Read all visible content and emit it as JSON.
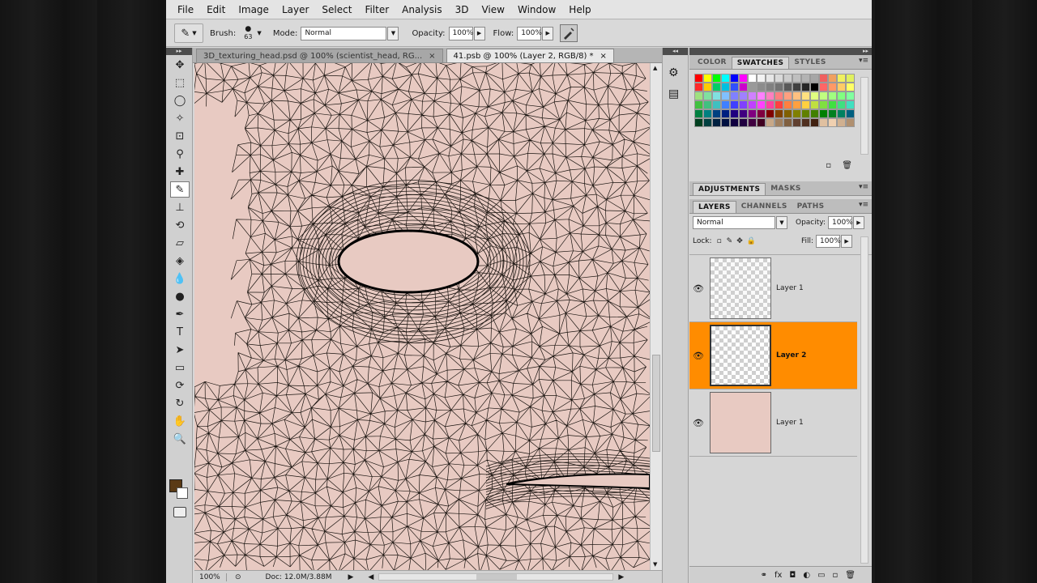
{
  "menu": [
    "File",
    "Edit",
    "Image",
    "Layer",
    "Select",
    "Filter",
    "Analysis",
    "3D",
    "View",
    "Window",
    "Help"
  ],
  "options": {
    "brush_label": "Brush:",
    "brush_size": "63",
    "mode_label": "Mode:",
    "mode_value": "Normal",
    "opacity_label": "Opacity:",
    "opacity_value": "100%",
    "flow_label": "Flow:",
    "flow_value": "100%"
  },
  "tabs": [
    {
      "label": "3D_texturing_head.psd @ 100% (scientist_head, RG...",
      "close": "×"
    },
    {
      "label": "41.psb @ 100% (Layer 2, RGB/8) *",
      "close": "×"
    }
  ],
  "status": {
    "zoom": "100%",
    "doc": "Doc: 12.0M/3.88M"
  },
  "swatches_panel": {
    "tabs": [
      "COLOR",
      "SWATCHES",
      "STYLES"
    ],
    "colors": [
      "#ff0000",
      "#ffff00",
      "#00ff00",
      "#00ffff",
      "#0000ff",
      "#ff00ff",
      "#ffffff",
      "#f2f2f2",
      "#e6e6e6",
      "#d9d9d9",
      "#cccccc",
      "#bfbfbf",
      "#b3b3b3",
      "#a6a6a6",
      "#f06060",
      "#f0a060",
      "#f0f060",
      "#e0f060",
      "#ff2a2a",
      "#ffcc00",
      "#00cc66",
      "#00c0e0",
      "#3050ff",
      "#cc00cc",
      "#999999",
      "#8c8c8c",
      "#808080",
      "#737373",
      "#595959",
      "#404040",
      "#262626",
      "#000000",
      "#ff6666",
      "#ff9966",
      "#ffcc66",
      "#ffff66",
      "#a0e080",
      "#80e0a0",
      "#80e0e0",
      "#80c0ff",
      "#8080ff",
      "#a080ff",
      "#d080ff",
      "#ff80ff",
      "#ff80c0",
      "#ff8080",
      "#ffa080",
      "#ffc080",
      "#ffe080",
      "#e0ff80",
      "#c0ff80",
      "#a0ff80",
      "#80ff80",
      "#80ffa0",
      "#40c040",
      "#40c080",
      "#40c0c0",
      "#4080ff",
      "#4040ff",
      "#8040ff",
      "#c040ff",
      "#ff40ff",
      "#ff40a0",
      "#ff4040",
      "#ff8040",
      "#ffa040",
      "#ffd040",
      "#c0e040",
      "#80e040",
      "#40e040",
      "#40e080",
      "#40e0c0",
      "#008040",
      "#008080",
      "#004080",
      "#002080",
      "#200080",
      "#400080",
      "#800080",
      "#800040",
      "#800000",
      "#804000",
      "#806000",
      "#808000",
      "#608000",
      "#408000",
      "#008000",
      "#008020",
      "#008060",
      "#006080",
      "#004020",
      "#004040",
      "#002040",
      "#001040",
      "#100040",
      "#200040",
      "#400040",
      "#400020",
      "#c8a888",
      "#a08060",
      "#806040",
      "#604030",
      "#503020",
      "#402010",
      "#e0c0a0",
      "#f0d0b0",
      "#d0b090",
      "#b09070"
    ]
  },
  "adjustments_panel": {
    "tabs": [
      "ADJUSTMENTS",
      "MASKS"
    ]
  },
  "layers_panel": {
    "tabs": [
      "LAYERS",
      "CHANNELS",
      "PATHS"
    ],
    "blend_mode": "Normal",
    "opacity_label": "Opacity:",
    "opacity_value": "100%",
    "lock_label": "Lock:",
    "fill_label": "Fill:",
    "fill_value": "100%",
    "layers": [
      {
        "name": "Layer 1",
        "selected": false,
        "thumb": "checker-sketch"
      },
      {
        "name": "Layer 2",
        "selected": true,
        "thumb": "checker"
      },
      {
        "name": "Layer 1",
        "selected": false,
        "thumb": "skin"
      }
    ]
  },
  "colors": {
    "skin": "#e8cac2",
    "selection": "#ff8c00",
    "foreground": "#5a3a15"
  }
}
